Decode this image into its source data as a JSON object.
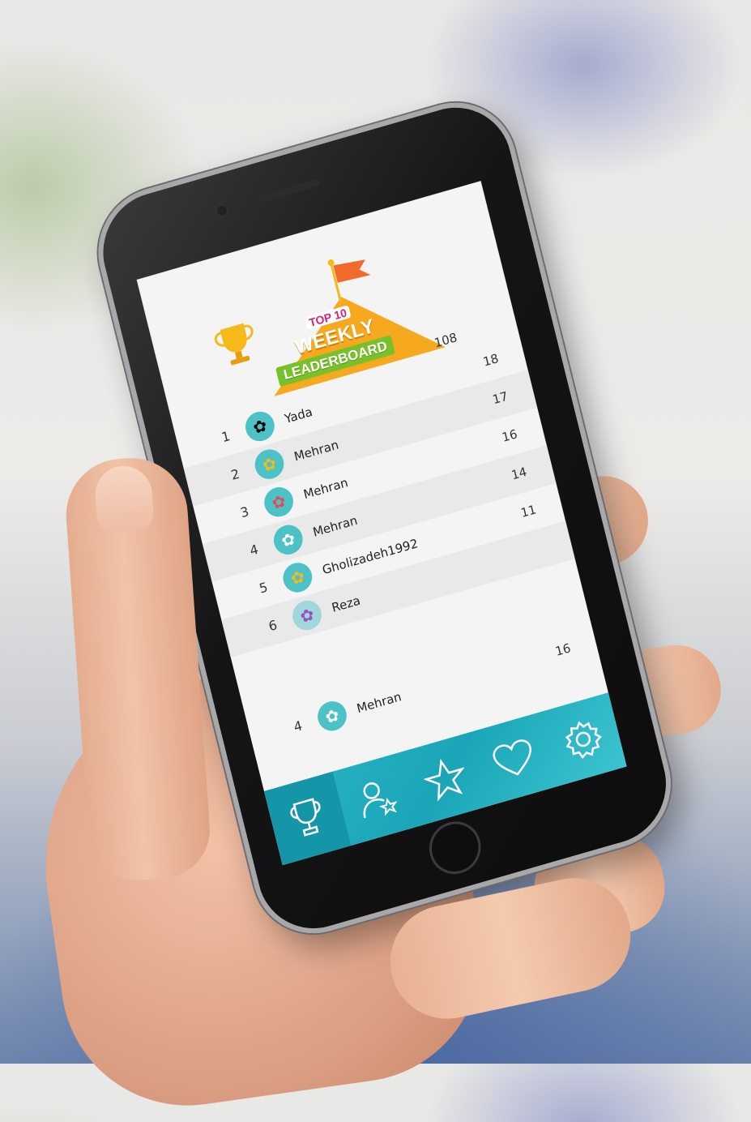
{
  "header": {
    "banner_top": "TOP 10",
    "banner_weekly": "WEEKLY",
    "banner_leaderboard": "LEADERBOARD",
    "score_header": "108"
  },
  "leaderboard": [
    {
      "rank": "1",
      "name": "Yada",
      "score": "18",
      "avatar_icon": "white-flower-icon"
    },
    {
      "rank": "2",
      "name": "Mehran",
      "score": "17",
      "avatar_icon": "yellow-flower-icon"
    },
    {
      "rank": "3",
      "name": "Mehran",
      "score": "16",
      "avatar_icon": "red-flower-icon"
    },
    {
      "rank": "4",
      "name": "Mehran",
      "score": "14",
      "avatar_icon": "white-flower-icon"
    },
    {
      "rank": "5",
      "name": "Gholizadeh1992",
      "score": "11",
      "avatar_icon": "yellow-flower-icon"
    },
    {
      "rank": "6",
      "name": "Reza",
      "score": "",
      "avatar_icon": "purple-flower-icon"
    }
  ],
  "current_user": {
    "rank": "4",
    "name": "Mehran",
    "score": "16",
    "avatar_icon": "white-flower-icon"
  },
  "tabs": [
    {
      "name": "leaderboard",
      "icon": "trophy-icon",
      "active": true
    },
    {
      "name": "friends",
      "icon": "user-star-icon",
      "active": false
    },
    {
      "name": "favorites",
      "icon": "star-icon",
      "active": false
    },
    {
      "name": "likes",
      "icon": "heart-icon",
      "active": false
    },
    {
      "name": "settings",
      "icon": "gear-icon",
      "active": false
    }
  ],
  "colors": {
    "accent": "#1aa6b8",
    "avatar_bg": "#4cc2c6",
    "banner_orange": "#f6a91e",
    "banner_green": "#79c12a",
    "banner_pink": "#d81f7b"
  }
}
